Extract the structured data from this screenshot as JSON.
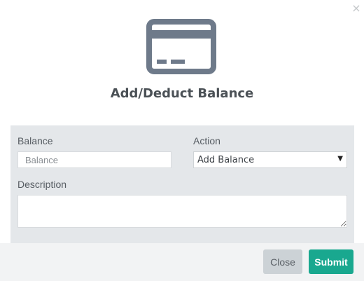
{
  "modal": {
    "close_glyph": "×",
    "title": "Add/Deduct Balance",
    "icon": "credit-card-icon"
  },
  "form": {
    "balance_label": "Balance",
    "balance_placeholder": "Balance",
    "balance_value": "",
    "action_label": "Action",
    "action_selected": "Add Balance",
    "description_label": "Description",
    "description_value": ""
  },
  "footer": {
    "close_label": "Close",
    "submit_label": "Submit"
  },
  "colors": {
    "icon": "#6e7a8a",
    "panel": "#e4e7ea",
    "submit": "#19a88f",
    "close": "#ccd2d6"
  }
}
